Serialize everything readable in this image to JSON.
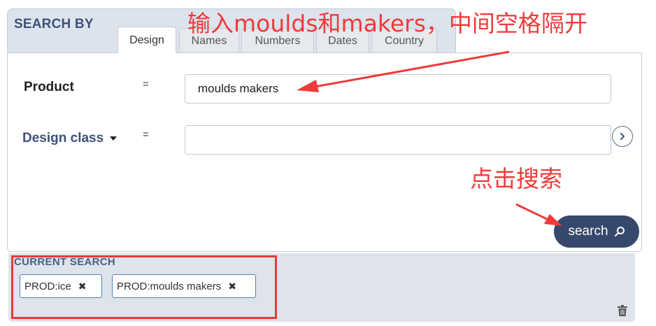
{
  "header": {
    "title": "SEARCH BY"
  },
  "tabs": [
    {
      "label": "Design",
      "active": true
    },
    {
      "label": "Names",
      "active": false
    },
    {
      "label": "Numbers",
      "active": false
    },
    {
      "label": "Dates",
      "active": false
    },
    {
      "label": "Country",
      "active": false
    }
  ],
  "form": {
    "product_label": "Product",
    "product_operator": "=",
    "product_value": "moulds makers",
    "design_class_label": "Design class",
    "design_class_operator": "=",
    "design_class_value": ""
  },
  "search_button": {
    "label": "search",
    "icon": "search-icon"
  },
  "current_search": {
    "title": "CURRENT SEARCH",
    "chips": [
      {
        "label": "PROD:ice"
      },
      {
        "label": "PROD:moulds makers"
      }
    ],
    "clear_icon": "trash-icon"
  },
  "annotations": {
    "input_hint": "输入moulds和makers，中间空格隔开",
    "search_hint": "点击搜索"
  },
  "colors": {
    "accent": "#36486b",
    "annotation": "#ef3b3b",
    "panel_bg": "#dde3ec",
    "chip_border": "#4a83b8"
  }
}
